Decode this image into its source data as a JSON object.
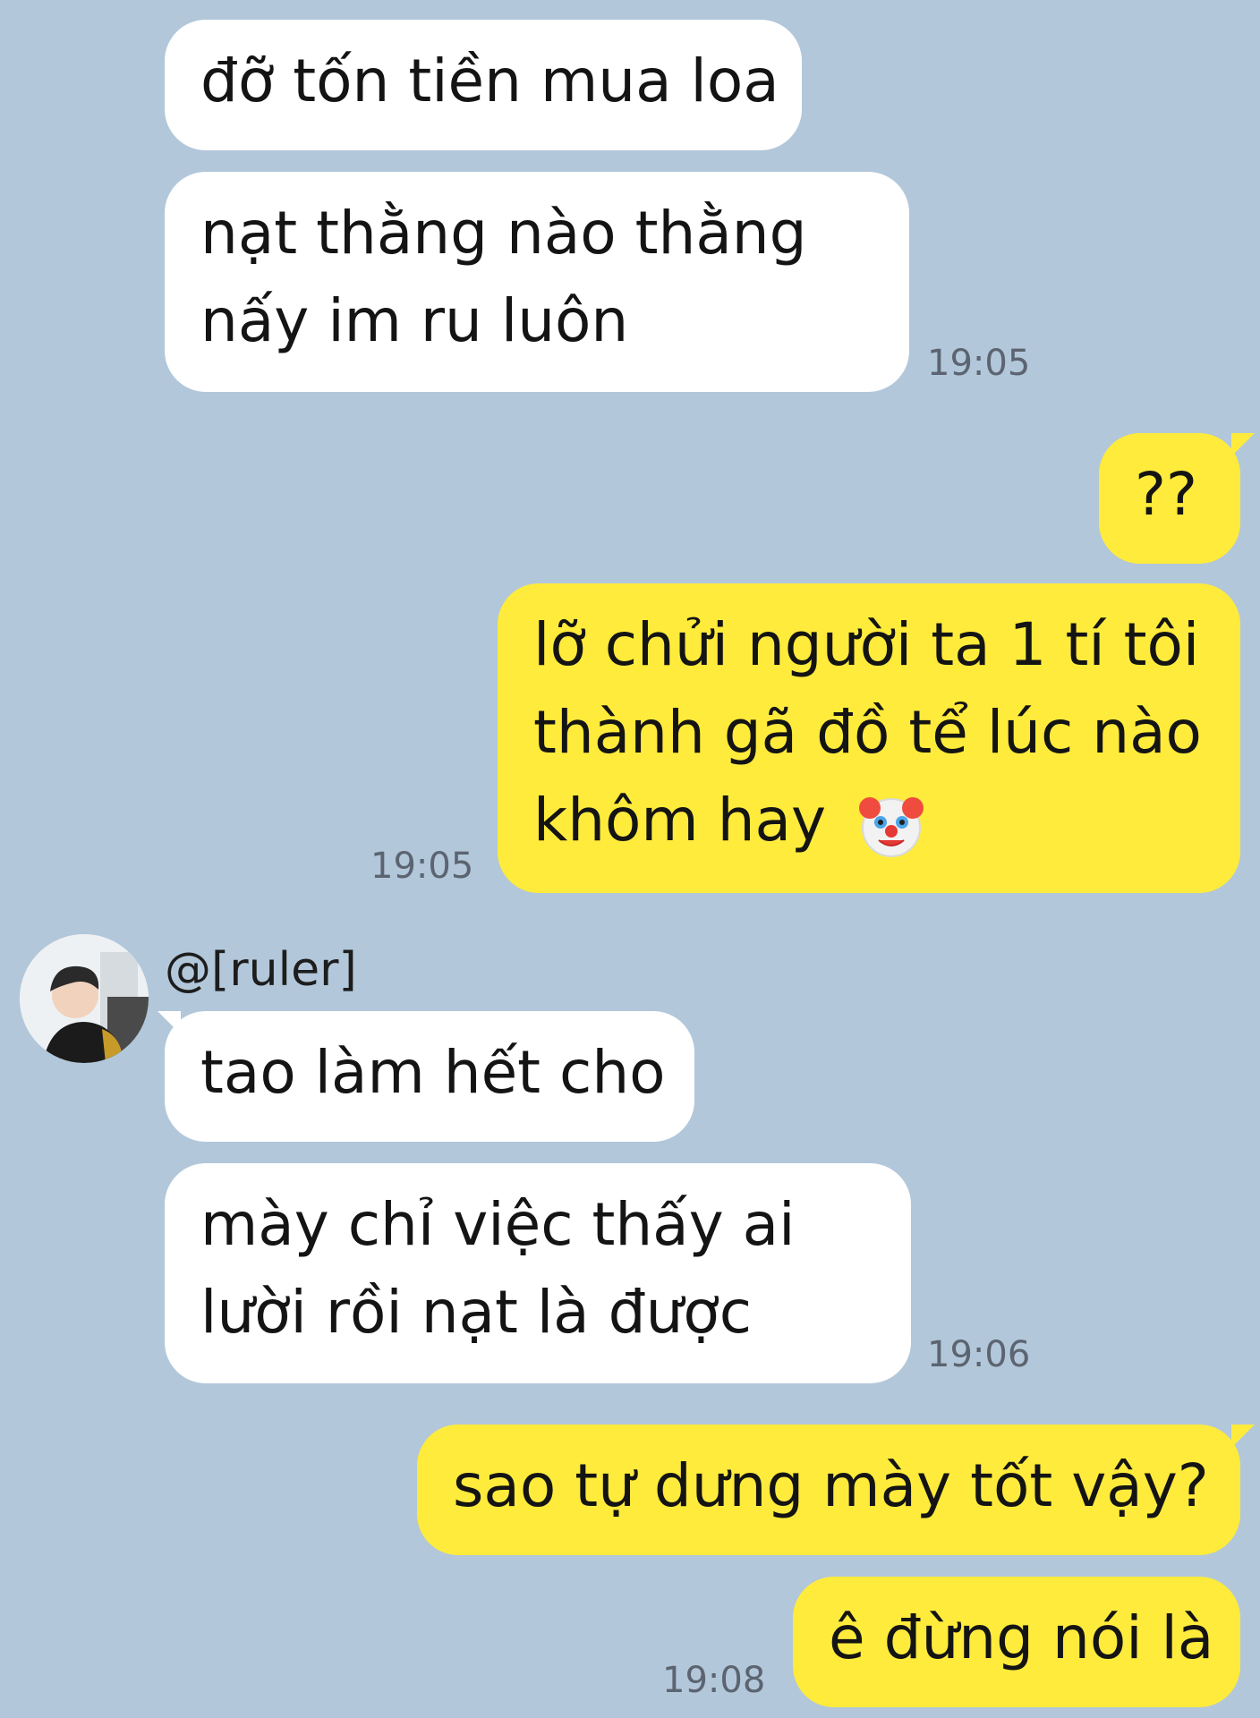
{
  "colors": {
    "background": "#b2c7da",
    "incoming_bubble": "#ffffff",
    "outgoing_bubble": "#ffeb3b"
  },
  "messages": [
    {
      "side": "incoming",
      "lines": [
        "đỡ tốn tiền mua loa"
      ]
    },
    {
      "side": "incoming",
      "lines": [
        "nạt thằng nào thằng",
        "nấy im ru luôn"
      ],
      "time": "19:05"
    },
    {
      "side": "outgoing",
      "lines": [
        "??"
      ]
    },
    {
      "side": "outgoing",
      "lines": [
        "lỡ chửi người ta 1 tí tôi",
        "thành gã đồ tể lúc nào",
        "khôm hay"
      ],
      "emoji": "clown-face-icon",
      "time": "19:05"
    },
    {
      "side": "incoming",
      "sender": "@[ruler]",
      "avatar": "user-avatar",
      "lines": [
        "tao làm hết cho"
      ]
    },
    {
      "side": "incoming",
      "lines": [
        "mày chỉ việc thấy ai",
        "lười rồi nạt là được"
      ],
      "time": "19:06"
    },
    {
      "side": "outgoing",
      "lines": [
        "sao tự dưng mày tốt vậy?"
      ]
    },
    {
      "side": "outgoing",
      "lines": [
        "ê đừng nói là"
      ],
      "time": "19:08"
    }
  ]
}
